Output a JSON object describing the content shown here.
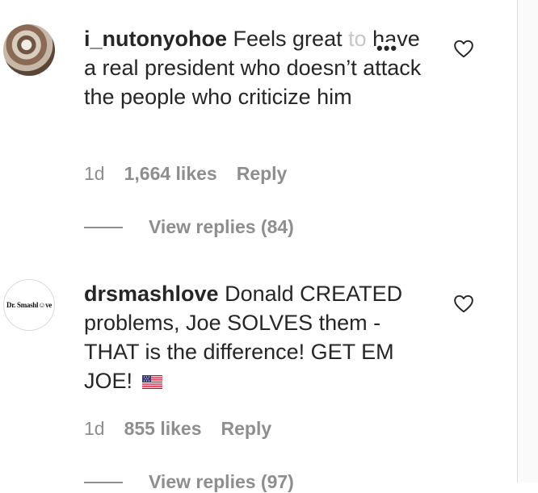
{
  "comments": [
    {
      "username": "i_nutonyohoe",
      "text_main": "Feels great",
      "text_faded": "to",
      "text_rest": "have a real president who doesn’t attack the people who criticize him",
      "time": "1d",
      "likes": "1,664 likes",
      "reply_label": "Reply",
      "view_replies": "View replies (84)",
      "more_icon": "more-options-icon",
      "heart_icon": "heart-icon"
    },
    {
      "username": "drsmashlove",
      "avatar_text": "Dr. Smashl☺ve",
      "text_main": "Donald CREATED problems, Joe SOLVES them - THAT is the difference! GET EM JOE!",
      "emoji": "us-flag-emoji",
      "time": "1d",
      "likes": "855 likes",
      "reply_label": "Reply",
      "view_replies": "View replies (97)",
      "heart_icon": "heart-icon"
    }
  ],
  "colors": {
    "text": "#262626",
    "muted": "#8e8e8e",
    "divider": "#dbdbdb"
  }
}
